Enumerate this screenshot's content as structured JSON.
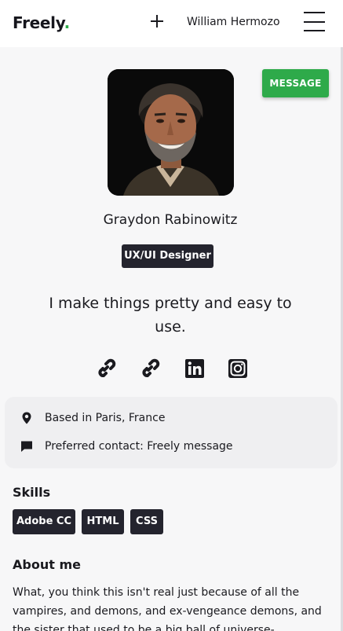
{
  "header": {
    "logo_text": "Freely",
    "logo_dot": ".",
    "user_name": "William Hermozo"
  },
  "profile": {
    "message_button": "MESSAGE",
    "name": "Graydon Rabinowitz",
    "role": "UX/UI Designer",
    "tagline": "I make things pretty and easy to use.",
    "social_links": [
      "link-icon",
      "link-icon",
      "linkedin-icon",
      "instagram-icon"
    ]
  },
  "info": {
    "location": "Based in Paris, France",
    "contact": "Preferred contact: Freely message"
  },
  "skills": {
    "title": "Skills",
    "items": [
      "Adobe CC",
      "HTML",
      "CSS"
    ]
  },
  "about": {
    "title": "About me",
    "text": "What, you think this isn't real just because of all the vampires, and demons, and ex-vengeance demons, and the sister that used to be a big ball of universe-destroying"
  },
  "colors": {
    "accent": "#2eaa4a",
    "badge": "#24242e",
    "background": "#f7f7f8",
    "card": "#efeff1"
  }
}
